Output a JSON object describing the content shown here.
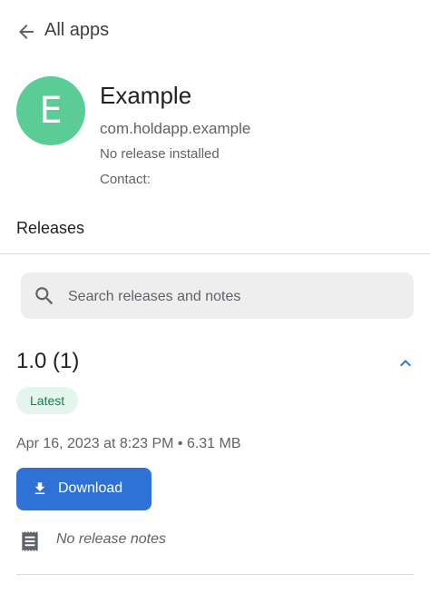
{
  "header": {
    "back_icon": "arrow-left-icon",
    "title": "All apps"
  },
  "app": {
    "avatar_letter": "E",
    "avatar_color": "#5ccc97",
    "name": "Example",
    "package": "com.holdapp.example",
    "status": "No release installed",
    "contact": "Contact:"
  },
  "releases": {
    "section_title": "Releases",
    "search": {
      "icon": "search-icon",
      "placeholder": "Search releases and notes",
      "value": ""
    },
    "items": [
      {
        "version": "1.0 (1)",
        "expanded": true,
        "toggle_icon": "chevron-up-icon",
        "badge": "Latest",
        "meta": "Apr 16, 2023 at 8:23 PM • 6.31 MB",
        "download_label": "Download",
        "download_icon": "download-icon",
        "notes_icon": "notes-icon",
        "notes": "No release notes"
      }
    ]
  },
  "colors": {
    "accent": "#2f72d6",
    "badge_bg": "#e3f5ed",
    "badge_text": "#1e7b4f"
  }
}
